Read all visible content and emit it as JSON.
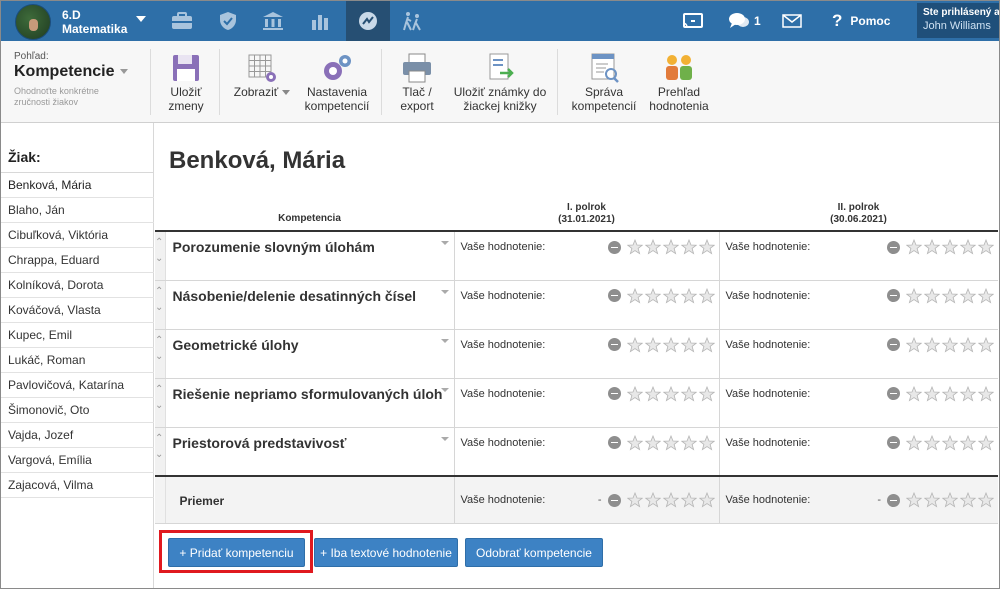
{
  "nav": {
    "class_name": "6.D",
    "subject": "Matematika",
    "notifications_count": "1",
    "help_label": "Pomoc",
    "user_label": "Ste prihlásený ako",
    "user_name": "John Williams"
  },
  "toolbar": {
    "view_label": "Pohľad:",
    "view_title": "Kompetencie",
    "view_hint": "Ohodnoťte konkrétne zručnosti žiakov",
    "save_line1": "Uložiť",
    "save_line2": "zmeny",
    "show_label": "Zobraziť",
    "settings_line1": "Nastavenia",
    "settings_line2": "kompetencií",
    "print_line1": "Tlač /",
    "print_line2": "export",
    "grades_line1": "Uložiť známky do",
    "grades_line2": "žiackej knižky",
    "manage_line1": "Správa",
    "manage_line2": "kompetencií",
    "overview_line1": "Prehľad",
    "overview_line2": "hodnotenia"
  },
  "sidebar": {
    "title": "Žiak:",
    "students": [
      "Benková, Mária",
      "Blaho, Ján",
      "Cibuľková, Viktória",
      "Chrappa, Eduard",
      "Kolníková, Dorota",
      "Kováčová, Vlasta",
      "Kupec, Emil",
      "Lukáč, Roman",
      "Pavlovičová, Katarína",
      "Šimonovič, Oto",
      "Vajda, Jozef",
      "Vargová, Emília",
      "Zajacová, Vilma"
    ]
  },
  "main": {
    "student_name": "Benková, Mária",
    "col_competence": "Kompetencia",
    "col_p1_title": "I. polrok",
    "col_p1_date": "(31.01.2021)",
    "col_p2_title": "II. polrok",
    "col_p2_date": "(30.06.2021)",
    "rating_label": "Vaše hodnotenie:",
    "competencies": [
      "Porozumenie slovným úlohám",
      "Násobenie/delenie desatinných čísel",
      "Geometrické úlohy",
      "Riešenie nepriamo sformulovaných úloh",
      "Priestorová predstavivosť"
    ],
    "average_label": "Priemer",
    "average_p1": "-",
    "average_p2": "-"
  },
  "buttons": {
    "add_competence": "+ Pridať kompetenciu",
    "text_only": "+ Iba textové hodnotenie",
    "remove_competence": "Odobrať kompetencie"
  },
  "colors": {
    "nav_bg": "#2e6fa8",
    "button_bg": "#3d82c4",
    "highlight": "#e0191f"
  }
}
